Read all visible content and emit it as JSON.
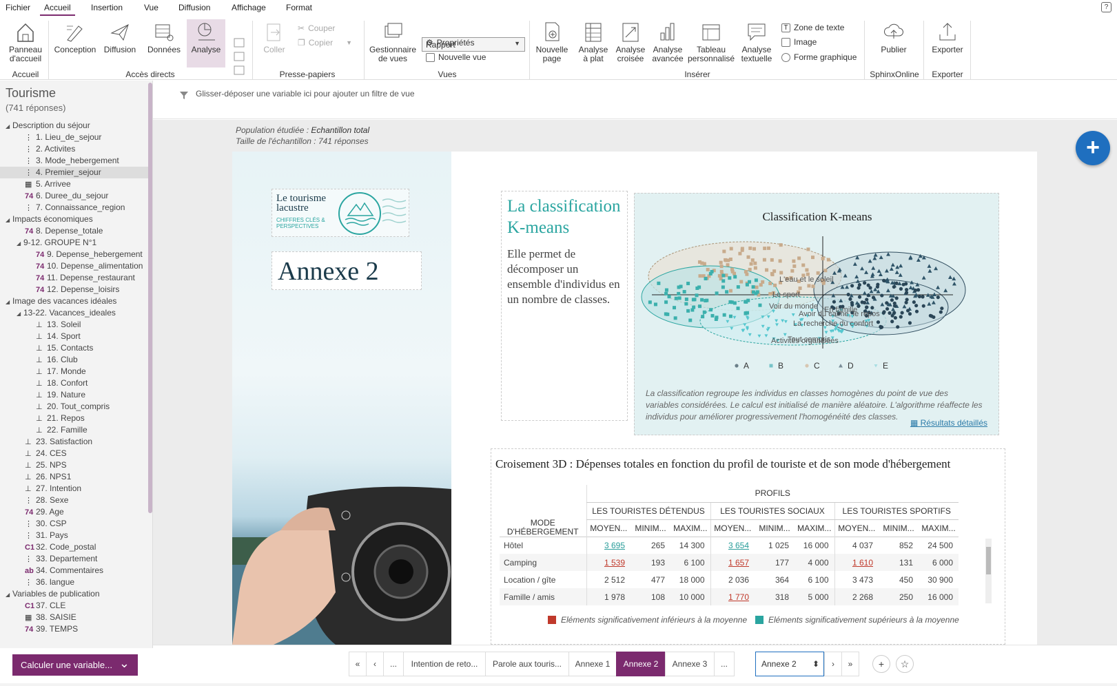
{
  "menu": {
    "items": [
      "Fichier",
      "Accueil",
      "Insertion",
      "Vue",
      "Diffusion",
      "Affichage",
      "Format"
    ],
    "active": "Accueil"
  },
  "ribbon": {
    "home": {
      "label": "Panneau d'accueil",
      "group": "Accueil"
    },
    "direct_access": {
      "items": [
        "Conception",
        "Diffusion",
        "Données",
        "Analyse"
      ],
      "group": "Accès directs"
    },
    "clipboard": {
      "paste": "Coller",
      "cut": "Couper",
      "copy": "Copier",
      "group": "Presse-papiers"
    },
    "views": {
      "manager": "Gestionnaire de vues",
      "select_value": "Rapport",
      "properties": "Propriétés",
      "new_view": "Nouvelle vue",
      "group": "Vues"
    },
    "insert": {
      "items": [
        "Nouvelle page",
        "Analyse à plat",
        "Analyse croisée",
        "Analyse avancée",
        "Tableau personnalisé",
        "Analyse textuelle"
      ],
      "text_zone": "Zone de texte",
      "image": "Image",
      "shape": "Forme graphique",
      "group": "Insérer"
    },
    "sphinx": {
      "label": "Publier",
      "group": "SphinxOnline"
    },
    "export": {
      "label": "Exporter",
      "group": "Exporter"
    }
  },
  "sidebar": {
    "title": "Tourisme",
    "count": "(741 réponses)",
    "tree": [
      {
        "t": "group",
        "label": "Description du séjour"
      },
      {
        "t": "var",
        "icon": "⋮",
        "label": "1. Lieu_de_sejour"
      },
      {
        "t": "var",
        "icon": "⋮",
        "label": "2. Activites"
      },
      {
        "t": "var",
        "icon": "⋮",
        "label": "3. Mode_hebergement"
      },
      {
        "t": "var",
        "icon": "⋮",
        "label": "4. Premier_sejour",
        "sel": true
      },
      {
        "t": "var",
        "icon": "▦",
        "label": "5. Arrivee"
      },
      {
        "t": "var",
        "icon": "74",
        "label": "6. Duree_du_sejour"
      },
      {
        "t": "var",
        "icon": "⋮",
        "label": "7. Connaissance_region"
      },
      {
        "t": "group",
        "label": "Impacts économiques"
      },
      {
        "t": "var",
        "icon": "74",
        "label": "8. Depense_totale"
      },
      {
        "t": "sub",
        "label": "9-12. GROUPE N°1"
      },
      {
        "t": "var2",
        "icon": "74",
        "label": "9. Depense_hebergement"
      },
      {
        "t": "var2",
        "icon": "74",
        "label": "10. Depense_alimentation"
      },
      {
        "t": "var2",
        "icon": "74",
        "label": "11. Depense_restaurant"
      },
      {
        "t": "var2",
        "icon": "74",
        "label": "12. Depense_loisirs"
      },
      {
        "t": "group",
        "label": "Image des vacances idéales"
      },
      {
        "t": "sub",
        "label": "13-22. Vacances_ideales"
      },
      {
        "t": "var2",
        "icon": "⊥",
        "label": "13. Soleil"
      },
      {
        "t": "var2",
        "icon": "⊥",
        "label": "14. Sport"
      },
      {
        "t": "var2",
        "icon": "⊥",
        "label": "15. Contacts"
      },
      {
        "t": "var2",
        "icon": "⊥",
        "label": "16. Club"
      },
      {
        "t": "var2",
        "icon": "⊥",
        "label": "17. Monde"
      },
      {
        "t": "var2",
        "icon": "⊥",
        "label": "18. Confort"
      },
      {
        "t": "var2",
        "icon": "⊥",
        "label": "19. Nature"
      },
      {
        "t": "var2",
        "icon": "⊥",
        "label": "20. Tout_compris"
      },
      {
        "t": "var2",
        "icon": "⊥",
        "label": "21. Repos"
      },
      {
        "t": "var2",
        "icon": "⊥",
        "label": "22. Famille"
      },
      {
        "t": "var",
        "icon": "⊥",
        "label": "23. Satisfaction"
      },
      {
        "t": "var",
        "icon": "⊥",
        "label": "24. CES"
      },
      {
        "t": "var",
        "icon": "⊥",
        "label": "25. NPS"
      },
      {
        "t": "var",
        "icon": "⊥",
        "label": "26. NPS1"
      },
      {
        "t": "var",
        "icon": "⊥",
        "label": "27. Intention"
      },
      {
        "t": "var",
        "icon": "⋮",
        "label": "28. Sexe"
      },
      {
        "t": "var",
        "icon": "74",
        "label": "29. Age"
      },
      {
        "t": "var",
        "icon": "⋮",
        "label": "30. CSP"
      },
      {
        "t": "var",
        "icon": "⋮",
        "label": "31. Pays"
      },
      {
        "t": "var",
        "icon": "C1",
        "label": "32. Code_postal"
      },
      {
        "t": "var",
        "icon": "⋮",
        "label": "33. Departement"
      },
      {
        "t": "var",
        "icon": "ab",
        "label": "34. Commentaires"
      },
      {
        "t": "var",
        "icon": "⋮",
        "label": "36. langue"
      },
      {
        "t": "group",
        "label": "Variables de publication"
      },
      {
        "t": "var",
        "icon": "C1",
        "label": "37. CLE"
      },
      {
        "t": "var",
        "icon": "▦",
        "label": "38. SAISIE"
      },
      {
        "t": "var",
        "icon": "74",
        "label": "39. TEMPS"
      }
    ],
    "calc_button": "Calculer une variable..."
  },
  "filter": {
    "text": "Glisser-déposer une variable ici pour ajouter un filtre de vue"
  },
  "population": {
    "label1": "Population étudiée : ",
    "value1": "Echantillon total",
    "label2": "Taille de l'échantillon : ",
    "value2": "741 réponses"
  },
  "page": {
    "logo_title": "Le tourisme lacustre",
    "logo_sub": "CHIFFRES CLÉS & PERSPECTIVES",
    "annexe_title": "Annexe 2",
    "km_title": "La classification K-means",
    "km_desc": "Elle permet de décomposer un ensemble d'individus en un nombre de classes.",
    "km_chart_title": "Classification K-means",
    "km_note": "La classification regroupe les individus en classes homogènes du point de vue des variables considérées. Le calcul est initialisé de manière aléatoire. L'algorithme réaffecte les individus pour améliorer progressivement l'homogénéité des classes.",
    "km_link": "Résultats détaillés",
    "km_labels": [
      "L'eau et le soleil",
      "Le sport",
      "Voir du monde",
      "En famille",
      "Avoir du calme, le repos",
      "La recherche du confort",
      "Tout compris",
      "Activités organisées"
    ],
    "km_legend": [
      "A",
      "B",
      "C",
      "D",
      "E"
    ],
    "cross_title": "Croisement 3D : Dépenses totales en fonction du profil de touriste et de son mode d'hébergement",
    "profils": "PROFILS",
    "mode_label": "MODE D'HÉBERGEMENT",
    "groups": [
      "LES TOURISTES DÉTENDUS",
      "LES TOURISTES SOCIAUX",
      "LES TOURISTES SPORTIFS"
    ],
    "subcols": [
      "MOYEN...",
      "MINIM...",
      "MAXIM..."
    ],
    "rows": [
      {
        "label": "Hôtel",
        "cells": [
          [
            "3 695",
            "high"
          ],
          [
            "265",
            ""
          ],
          [
            "14 300",
            ""
          ],
          [
            "3 654",
            "high"
          ],
          [
            "1 025",
            ""
          ],
          [
            "16 000",
            ""
          ],
          [
            "4 037",
            ""
          ],
          [
            "852",
            ""
          ],
          [
            "24 500",
            ""
          ]
        ]
      },
      {
        "label": "Camping",
        "cells": [
          [
            "1 539",
            "low"
          ],
          [
            "193",
            ""
          ],
          [
            "6 100",
            ""
          ],
          [
            "1 657",
            "low"
          ],
          [
            "177",
            ""
          ],
          [
            "4 000",
            ""
          ],
          [
            "1 610",
            "low"
          ],
          [
            "131",
            ""
          ],
          [
            "6 000",
            ""
          ]
        ]
      },
      {
        "label": "Location / gîte",
        "cells": [
          [
            "2 512",
            ""
          ],
          [
            "477",
            ""
          ],
          [
            "18 000",
            ""
          ],
          [
            "2 036",
            ""
          ],
          [
            "364",
            ""
          ],
          [
            "6 100",
            ""
          ],
          [
            "3 473",
            ""
          ],
          [
            "450",
            ""
          ],
          [
            "30 900",
            ""
          ]
        ]
      },
      {
        "label": "Famille / amis",
        "cells": [
          [
            "1 978",
            ""
          ],
          [
            "108",
            ""
          ],
          [
            "10 000",
            ""
          ],
          [
            "1 770",
            "low"
          ],
          [
            "318",
            ""
          ],
          [
            "5 000",
            ""
          ],
          [
            "2 268",
            ""
          ],
          [
            "250",
            ""
          ],
          [
            "16 000",
            ""
          ]
        ]
      }
    ],
    "legend_low": "Eléments significativement inférieurs à la moyenne",
    "legend_high": "Eléments significativement supérieurs à la moyenne",
    "colors": {
      "low": "#c0392b",
      "high": "#2aa5a0",
      "accent": "#7b2a6e",
      "fab": "#1f6fbf"
    }
  },
  "pager": {
    "tabs": [
      "«",
      "‹",
      "...",
      "Intention de reto...",
      "Parole aux touris...",
      "Annexe 1",
      "Annexe 2",
      "Annexe 3",
      "...",
      "›",
      "»"
    ],
    "active": "Annexe 2",
    "select": "Annexe 2"
  }
}
